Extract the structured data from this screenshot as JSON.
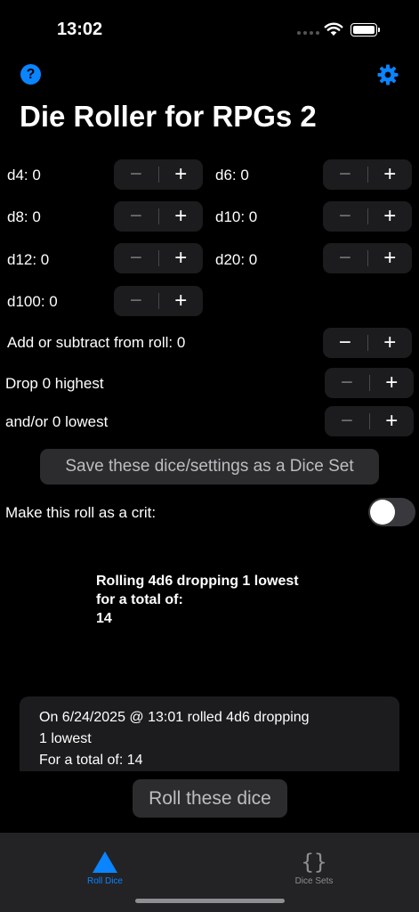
{
  "status": {
    "time": "13:02"
  },
  "header": {
    "title": "Die Roller for RPGs 2",
    "help_icon": "?"
  },
  "dice": {
    "d4": "d4: 0",
    "d6": "d6: 0",
    "d8": "d8: 0",
    "d10": "d10: 0",
    "d12": "d12: 0",
    "d20": "d20: 0",
    "d100": "d100: 0"
  },
  "modifiers": {
    "add": "Add or subtract from roll: 0",
    "drop_high": "Drop 0 highest",
    "drop_low": "and/or 0 lowest"
  },
  "stepper": {
    "minus": "−",
    "plus": "+"
  },
  "save_button": "Save these dice/settings as a Dice Set",
  "crit": {
    "label": "Make this roll as a crit:",
    "on": false
  },
  "result": "Rolling 4d6 dropping 1 lowest\nfor a total of:\n14",
  "history": {
    "line1": "On 6/24/2025 @ 13:01 rolled 4d6  dropping",
    "line2": "1 lowest",
    "line3": "For a total of: 14"
  },
  "roll_button": "Roll these dice",
  "tabs": {
    "roll_dice": "Roll Dice",
    "dice_sets": "Dice Sets",
    "dice_sets_glyph": "{}"
  },
  "colors": {
    "accent": "#0a84ff",
    "background": "#000000",
    "inactive_tab": "#8e8e93"
  }
}
